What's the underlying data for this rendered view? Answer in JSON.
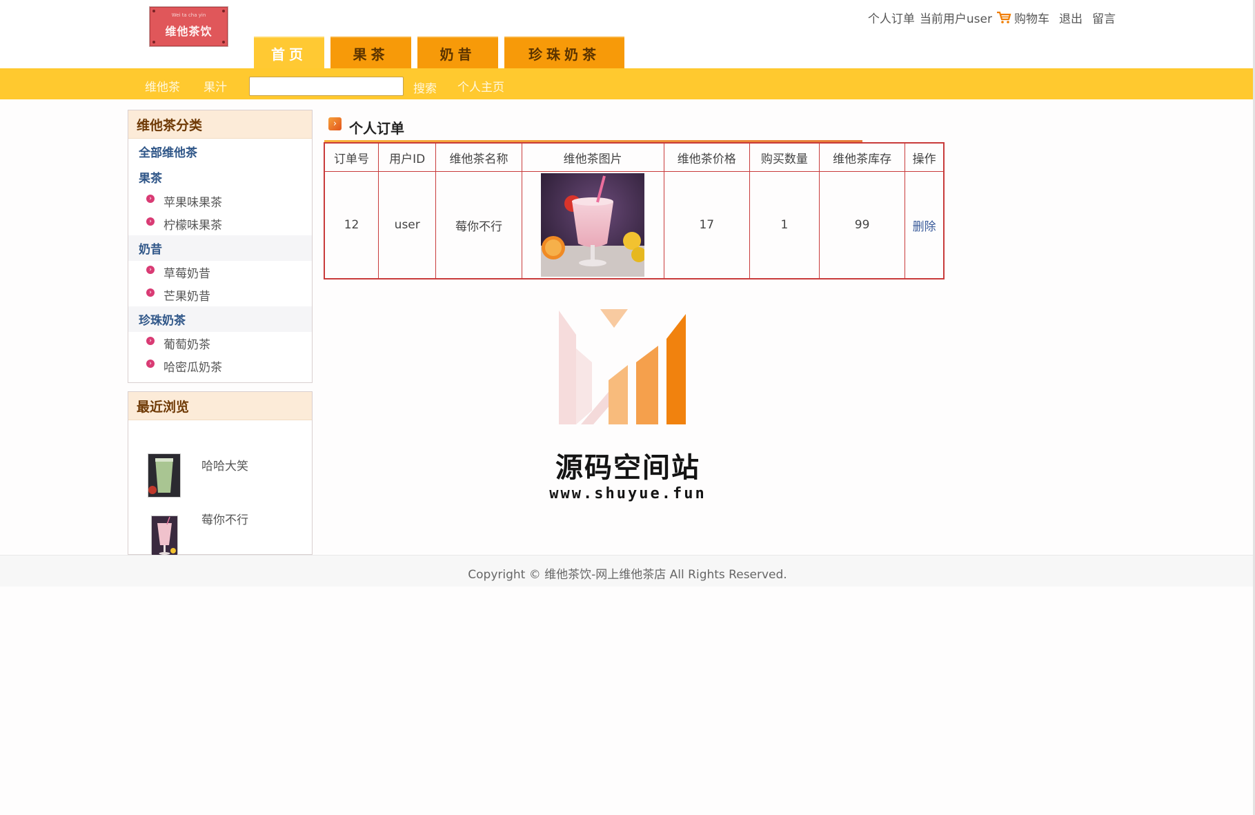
{
  "header": {
    "logo_small": "Wei ta cha yin",
    "logo_text": "维他茶饮",
    "my_orders": "个人订单",
    "current_user": "当前用户user",
    "cart": "购物车",
    "logout": "退出",
    "message": "留言",
    "cart_icon_color": "#f07d00"
  },
  "nav": {
    "tabs": [
      {
        "label": "首页",
        "active": true
      },
      {
        "label": "果茶",
        "active": false
      },
      {
        "label": "奶昔",
        "active": false
      },
      {
        "label": "珍珠奶茶",
        "active": false
      }
    ]
  },
  "subnav": {
    "links": [
      "维他茶",
      "果汁"
    ],
    "search_value": "",
    "search_button": "搜索",
    "profile": "个人主页"
  },
  "sidebar": {
    "category_title": "维他茶分类",
    "all": "全部维他茶",
    "groups": [
      {
        "name": "果茶",
        "items": [
          "苹果味果茶",
          "柠檬味果茶"
        ]
      },
      {
        "name": "奶昔",
        "items": [
          "草莓奶昔",
          "芒果奶昔"
        ]
      },
      {
        "name": "珍珠奶茶",
        "items": [
          "葡萄奶茶",
          "哈密瓜奶茶"
        ]
      }
    ],
    "recent_title": "最近浏览",
    "recent": [
      {
        "name": "哈哈大笑"
      },
      {
        "name": "莓你不行"
      }
    ]
  },
  "orders": {
    "title": "个人订单",
    "columns": [
      "订单号",
      "用户ID",
      "维他茶名称",
      "维他茶图片",
      "维他茶价格",
      "购买数量",
      "维他茶库存",
      "操作"
    ],
    "rows": [
      {
        "order_no": "12",
        "user_id": "user",
        "name": "莓你不行",
        "price": "17",
        "quantity": "1",
        "stock": "99",
        "action": "删除"
      }
    ]
  },
  "watermark": {
    "title": "源码空间站",
    "url": "www.shuyue.fun"
  },
  "footer": {
    "copyright": "Copyright © 维他茶饮-网上维他茶店 All Rights Reserved."
  },
  "colors": {
    "accent_yellow": "#ffc92f",
    "tab_orange": "#f79a09",
    "table_border": "#c83a3a",
    "category_blue": "#2f5688"
  }
}
